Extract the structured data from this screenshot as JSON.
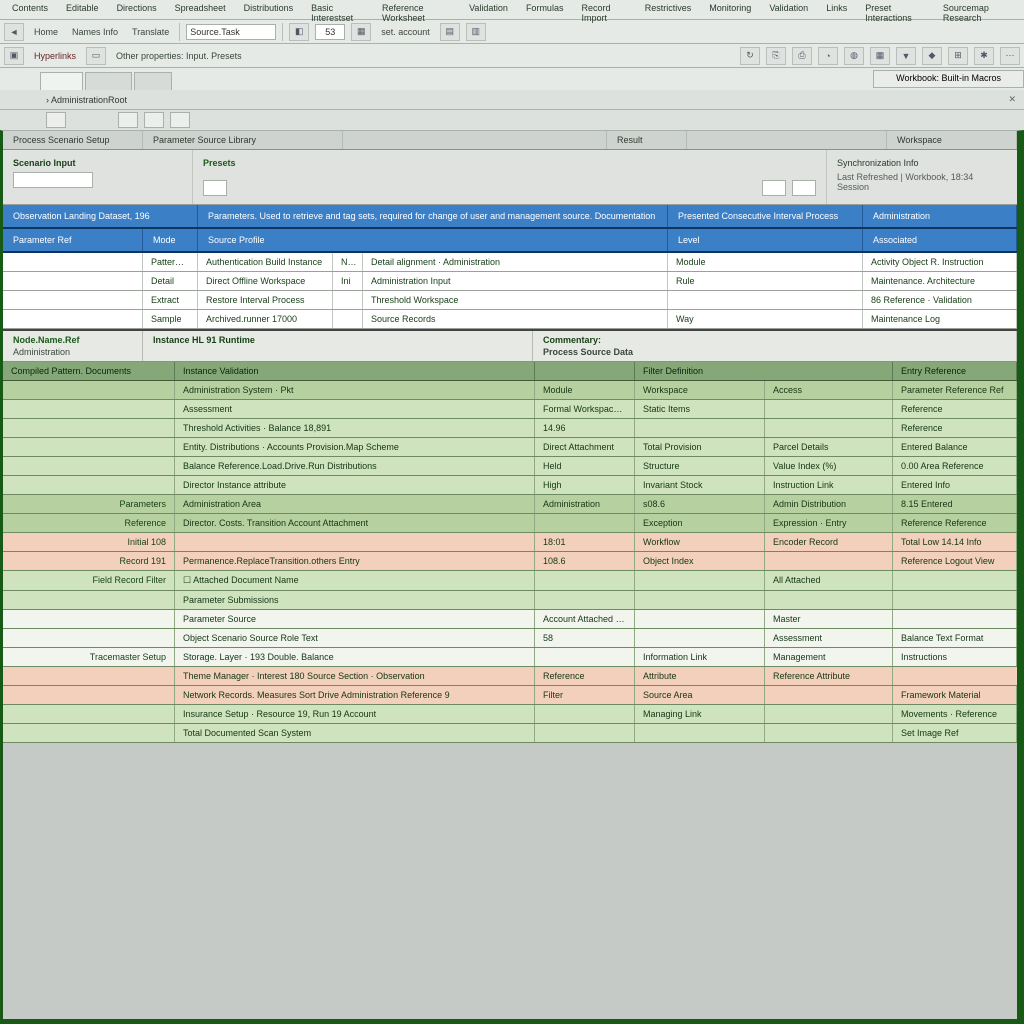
{
  "menu": [
    "Contents",
    "Editable",
    "Directions",
    "Spreadsheet",
    "Distributions",
    "Basic Interestset",
    "Reference Worksheet",
    "Validation",
    "Formulas",
    "Record Import",
    "Restrictives",
    "Monitoring",
    "Validation",
    "Links",
    "Preset Interactions",
    "Sourcemap Research"
  ],
  "tb1": {
    "labels": [
      "Home",
      "Names Info",
      "Translate"
    ],
    "search": "Source.Task",
    "code": "53",
    "suffix": "set. account"
  },
  "tb2": {
    "mode": "Hyperlinks",
    "helper": "Other properties: Input. Presets"
  },
  "tabs": {
    "left": [
      "",
      "",
      ""
    ],
    "right": "Workbook: Built-in Macros"
  },
  "breadcrumb": "› AdministrationRoot",
  "sec1": {
    "cols": [
      "Process Scenario Setup",
      "Parameter Source Library",
      "",
      "Result",
      "",
      "Workspace"
    ]
  },
  "form": {
    "left_label": "Scenario Input",
    "mid_title": "Presets",
    "right_title": "Synchronization Info",
    "right_sub": "Last Refreshed | Workbook, 18:34 Session"
  },
  "blue1": [
    "Observation Landing Dataset, 196",
    "Parameters. Used to retrieve and tag sets, required for change of user and management source. Documentation",
    "Presented Consecutive Interval Process",
    "Administration"
  ],
  "blue2": [
    "Parameter Ref",
    "Mode",
    "Source Profile",
    "Level",
    "Associated"
  ],
  "wrows": [
    {
      "c": [
        "",
        "PatternNode",
        "Authentication Build Instance",
        "New",
        "Detail alignment · Administration",
        "Module",
        "Activity Object R. Instruction"
      ]
    },
    {
      "c": [
        "",
        "Detail",
        "Direct Offline Workspace",
        "Ini",
        "Administration Input",
        "Rule",
        "Maintenance. Architecture"
      ]
    },
    {
      "c": [
        "",
        "Extract",
        "Restore Interval Process",
        "",
        "Threshold Workspace",
        "",
        "86 Reference · Validation"
      ]
    },
    {
      "c": [
        "",
        "Sample",
        "Archived.runner 17000",
        "",
        "Source Records",
        "Way",
        "Maintenance Log"
      ]
    }
  ],
  "midhdr": {
    "l1": "Node.Name.Ref",
    "l2": "Administration",
    "m": "Instance HL 91 Runtime",
    "r1": "Commentary:",
    "r2": "Process Source Data"
  },
  "ghdr": [
    "Compiled Pattern. Documents",
    "Instance Validation",
    "",
    "Filter Definition",
    "Entry Reference"
  ],
  "grows": [
    {
      "cls": "bg-mg",
      "c": [
        "",
        "Administration System · Pkt",
        "Module",
        "Workspace",
        "Access",
        "Parameter   Reference Ref"
      ]
    },
    {
      "cls": "bg-lg",
      "c": [
        "",
        "Assessment",
        "Formal Workspace Setup",
        "Static Items",
        "",
        "Reference"
      ]
    },
    {
      "cls": "bg-lg",
      "c": [
        "",
        "Threshold Activities · Balance  18,891",
        "14.96",
        "",
        "",
        "Reference"
      ]
    },
    {
      "cls": "bg-lg",
      "c": [
        "",
        "Entity. Distributions · Accounts Provision.Map Scheme",
        "Direct Attachment",
        "Total Provision",
        "Parcel Details",
        "Entered   Balance"
      ]
    },
    {
      "cls": "bg-lg",
      "c": [
        "",
        "Balance Reference.Load.Drive.Run  Distributions",
        "Held",
        "Structure",
        "Value Index (%)",
        "0.00 Area   Reference"
      ]
    },
    {
      "cls": "bg-lg",
      "c": [
        "",
        "Director       Instance attribute",
        "High",
        "Invariant Stock",
        "Instruction Link",
        "Entered   Info"
      ]
    },
    {
      "cls": "bg-mg",
      "c": [
        "Parameters",
        "Administration Area",
        "Administration",
        "s08.6",
        "Admin Distribution",
        "8.15   Entered"
      ]
    },
    {
      "cls": "bg-mg",
      "c": [
        "Reference",
        "Director. Costs. Transition Account Attachment",
        "",
        "Exception",
        "Expression · Entry",
        "Reference   Reference"
      ]
    },
    {
      "cls": "bg-pk",
      "c": [
        "Initial 108",
        "",
        "18:01",
        "Workflow",
        "Encoder Record",
        "Total Low   14.14 Info"
      ]
    },
    {
      "cls": "bg-pk",
      "c": [
        "Record 191",
        "Permanence.ReplaceTransition.others Entry",
        "108.6",
        "Object Index",
        "",
        "Reference   Logout View"
      ]
    },
    {
      "cls": "bg-lg chk",
      "c": [
        "Field Record Filter",
        "☐  Attached Document Name",
        "",
        "",
        "All Attached",
        ""
      ]
    },
    {
      "cls": "bg-lg",
      "c": [
        "",
        "Parameter Submissions",
        "",
        "",
        "",
        ""
      ]
    },
    {
      "cls": "bg-wt",
      "c": [
        "",
        "Parameter Source",
        "Account Attached Statement",
        "",
        "Master",
        ""
      ]
    },
    {
      "cls": "bg-wt",
      "c": [
        "",
        "Object Scenario Source Role Text",
        "58",
        "",
        "Assessment",
        "Balance   Text Format"
      ]
    },
    {
      "cls": "bg-wt",
      "c": [
        "Tracemaster Setup",
        "Storage. Layer · 193 Double. Balance",
        "",
        "Information Link",
        "Management",
        "Instructions"
      ]
    },
    {
      "cls": "bg-pk",
      "c": [
        "",
        "Theme Manager · Interest  180 Source Section · Observation",
        "Reference",
        "Attribute",
        "Reference   Attribute"
      ]
    },
    {
      "cls": "bg-pk",
      "c": [
        "",
        "Network Records. Measures   Sort  Drive Administration Reference  9",
        "Filter",
        "Source Area",
        "",
        "Framework   Material"
      ]
    },
    {
      "cls": "bg-lg",
      "c": [
        "",
        "Insurance Setup · Resource 19, Run 19 Account",
        "",
        "Managing Link",
        "",
        "Movements · Reference"
      ]
    },
    {
      "cls": "bg-lg",
      "c": [
        "",
        "Total Documented Scan System",
        "",
        "",
        "",
        "Set Image Ref"
      ]
    }
  ]
}
